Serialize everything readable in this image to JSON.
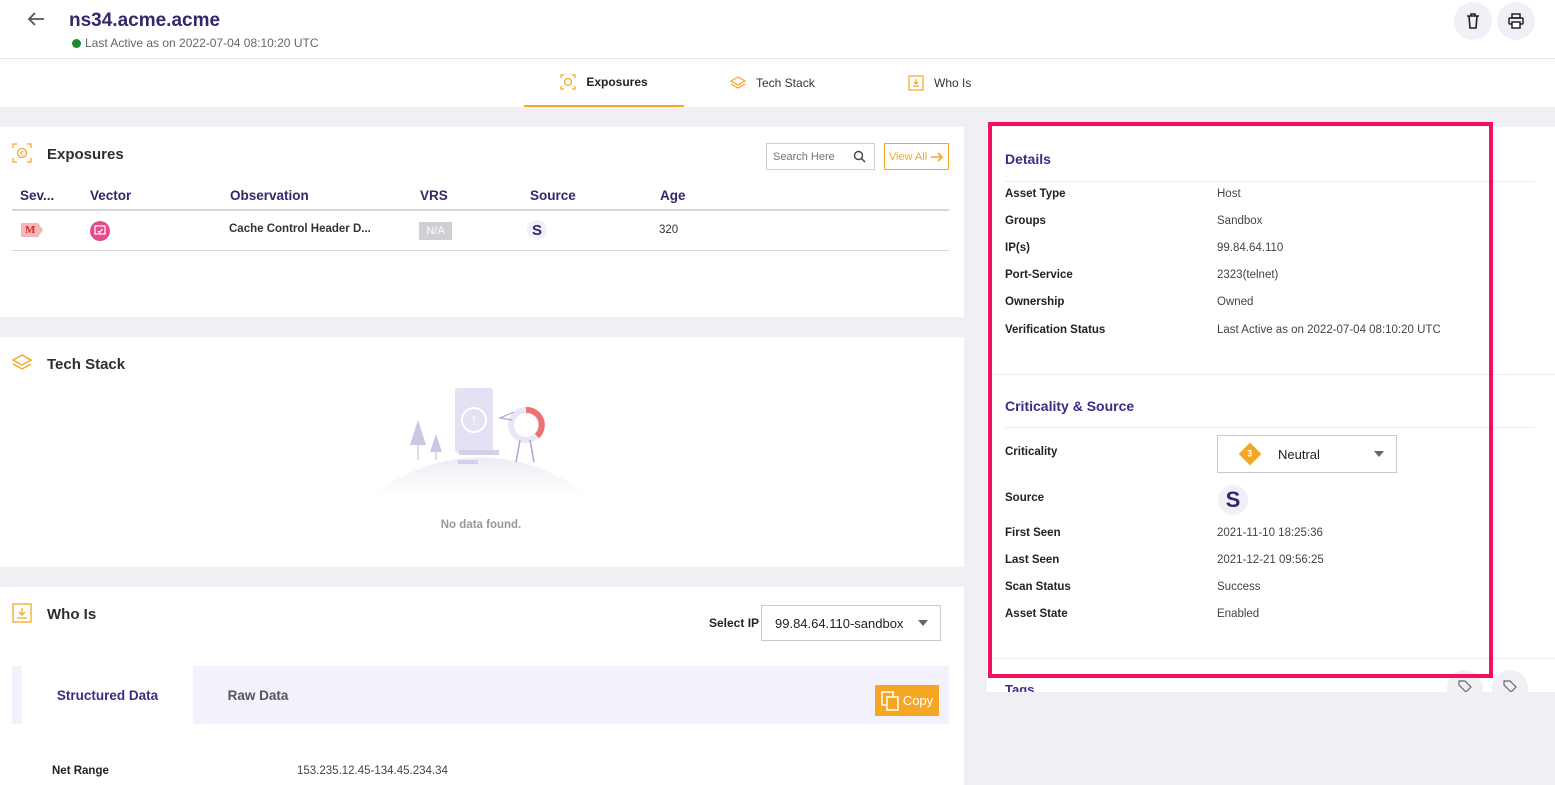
{
  "header": {
    "title": "ns34.acme.acme",
    "last_active": "Last Active as on 2022-07-04 08:10:20 UTC"
  },
  "tabs": [
    {
      "label": "Exposures",
      "active": true
    },
    {
      "label": "Tech Stack",
      "active": false
    },
    {
      "label": "Who Is",
      "active": false
    }
  ],
  "exposures": {
    "title": "Exposures",
    "search_placeholder": "Search Here",
    "view_all": "View All",
    "columns": [
      "Sev...",
      "Vector",
      "Observation",
      "VRS",
      "Source",
      "Age"
    ],
    "rows": [
      {
        "severity": "M",
        "observation": "Cache Control Header D...",
        "vrs": "N/A",
        "source": "S",
        "age": "320"
      }
    ]
  },
  "tech_stack": {
    "title": "Tech Stack",
    "empty_text": "No data found."
  },
  "whois": {
    "title": "Who Is",
    "select_ip_label": "Select IP",
    "select_ip_value": "99.84.64.110-sandbox",
    "subtabs": [
      "Structured Data",
      "Raw Data"
    ],
    "copy_label": "Copy",
    "net_range_label": "Net Range",
    "net_range_value": "153.235.12.45-134.45.234.34"
  },
  "details": {
    "title": "Details",
    "rows": [
      {
        "label": "Asset Type",
        "value": "Host"
      },
      {
        "label": "Groups",
        "value": "Sandbox"
      },
      {
        "label": "IP(s)",
        "value": "99.84.64.110"
      },
      {
        "label": "Port-Service",
        "value": "2323(telnet)"
      },
      {
        "label": "Ownership",
        "value": "Owned"
      },
      {
        "label": "Verification Status",
        "value": "Last Active as on 2022-07-04 08:10:20 UTC"
      }
    ]
  },
  "criticality_source": {
    "title": "Criticality & Source",
    "criticality_label": "Criticality",
    "criticality_badge": "3",
    "criticality_value": "Neutral",
    "source_label": "Source",
    "source_value": "S",
    "rows": [
      {
        "label": "First Seen",
        "value": "2021-11-10 18:25:36"
      },
      {
        "label": "Last Seen",
        "value": "2021-12-21 09:56:25"
      },
      {
        "label": "Scan Status",
        "value": "Success"
      },
      {
        "label": "Asset State",
        "value": "Enabled"
      }
    ]
  },
  "tags": {
    "title": "Tags"
  },
  "colors": {
    "brand_purple": "#2f2a6b",
    "accent_orange": "#f5a623",
    "highlight": "#f2125b",
    "status_green": "#1a8a2a"
  }
}
